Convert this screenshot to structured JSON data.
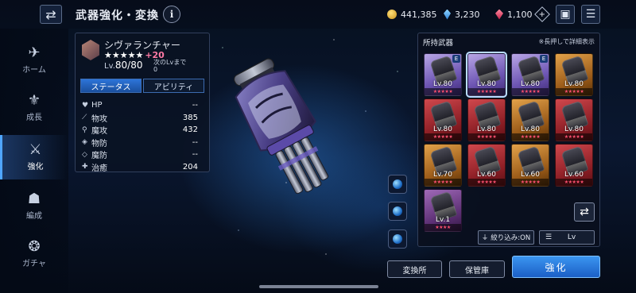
{
  "header": {
    "title": "武器強化・変換",
    "info_label": "i",
    "currencies": {
      "gold": "441,385",
      "crystal": "3,230",
      "gem": "1,100"
    }
  },
  "sidenav": [
    {
      "label": "ホーム",
      "icon": "home-icon",
      "active": false
    },
    {
      "label": "成長",
      "icon": "growth-icon",
      "active": false
    },
    {
      "label": "強化",
      "icon": "enhance-icon",
      "active": true
    },
    {
      "label": "編成",
      "icon": "party-icon",
      "active": false
    },
    {
      "label": "ガチャ",
      "icon": "gacha-icon",
      "active": false
    }
  ],
  "weapon": {
    "name": "シヴァランチャー",
    "stars": "★★★★★",
    "plus": "+20",
    "lv_prefix": "Lv.",
    "lv": "80/80",
    "next_lv_label": "次のLvまで",
    "next_lv_value": "0",
    "tabs": [
      "ステータス",
      "アビリティ"
    ],
    "stats": [
      {
        "icon": "heart-icon",
        "glyph": "♥",
        "name": "HP",
        "value": "--"
      },
      {
        "icon": "sword-icon",
        "glyph": "⟋",
        "name": "物攻",
        "value": "385"
      },
      {
        "icon": "staff-icon",
        "glyph": "⚲",
        "name": "魔攻",
        "value": "432"
      },
      {
        "icon": "shield-icon",
        "glyph": "◈",
        "name": "物防",
        "value": "--"
      },
      {
        "icon": "magic-shield-icon",
        "glyph": "◇",
        "name": "魔防",
        "value": "--"
      },
      {
        "icon": "heal-icon",
        "glyph": "✚",
        "name": "治癒",
        "value": "204"
      }
    ]
  },
  "inventory": {
    "title": "所持武器",
    "hint": "※長押しで詳細表示",
    "cards": [
      {
        "rarity": "purple",
        "lv": "Lv.80",
        "stars": "★★★★★",
        "badge": "E",
        "selected": false
      },
      {
        "rarity": "purple",
        "lv": "Lv.80",
        "stars": "★★★★★",
        "badge": "",
        "selected": true
      },
      {
        "rarity": "purple",
        "lv": "Lv.80",
        "stars": "★★★★★",
        "badge": "E",
        "selected": false
      },
      {
        "rarity": "orange",
        "lv": "Lv.80",
        "stars": "★★★★★",
        "badge": "",
        "selected": false
      },
      {
        "rarity": "red",
        "lv": "Lv.80",
        "stars": "★★★★★",
        "badge": "",
        "selected": false
      },
      {
        "rarity": "red",
        "lv": "Lv.80",
        "stars": "★★★★★",
        "badge": "",
        "selected": false
      },
      {
        "rarity": "orange",
        "lv": "Lv.80",
        "stars": "★★★★★",
        "badge": "",
        "selected": false
      },
      {
        "rarity": "red",
        "lv": "Lv.80",
        "stars": "★★★★★",
        "badge": "",
        "selected": false
      },
      {
        "rarity": "orange",
        "lv": "Lv.70",
        "stars": "★★★★★",
        "badge": "",
        "selected": false
      },
      {
        "rarity": "red",
        "lv": "Lv.60",
        "stars": "★★★★★",
        "badge": "",
        "selected": false
      },
      {
        "rarity": "orange",
        "lv": "Lv.60",
        "stars": "★★★★★",
        "badge": "",
        "selected": false
      },
      {
        "rarity": "red",
        "lv": "Lv.60",
        "stars": "★★★★★",
        "badge": "",
        "selected": false
      },
      {
        "rarity": "violet",
        "lv": "Lv.1",
        "stars": "★★★★",
        "badge": "",
        "selected": false
      }
    ],
    "filter_label": "絞り込み:ON",
    "sort_label": "Lv"
  },
  "buttons": {
    "exchange": "変換所",
    "storage": "保管庫",
    "enhance": "強化"
  },
  "colors": {
    "accent": "#2d74d8",
    "plus": "#ff7aa5"
  }
}
